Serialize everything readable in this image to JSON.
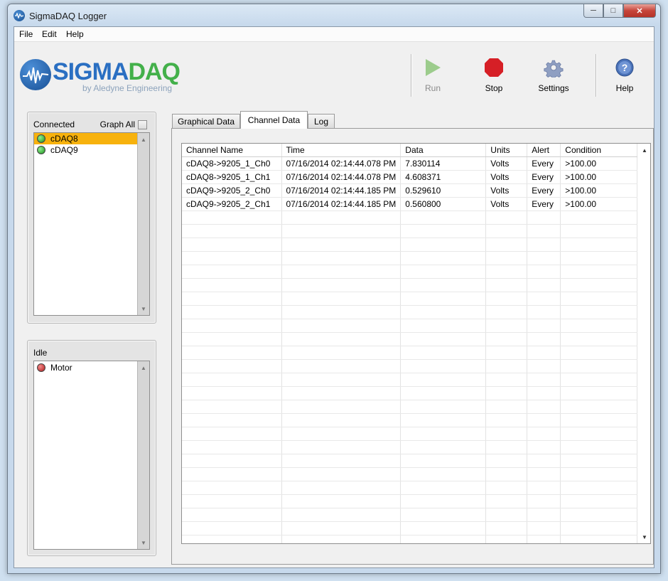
{
  "window": {
    "title": "SigmaDAQ Logger"
  },
  "menu": {
    "file": "File",
    "edit": "Edit",
    "help": "Help"
  },
  "logo": {
    "sigma": "SIGMA",
    "daq": "DAQ",
    "subtitle": "by Aledyne Engineering"
  },
  "toolbar": {
    "run": "Run",
    "stop": "Stop",
    "settings": "Settings",
    "help": "Help"
  },
  "connected": {
    "header": "Connected",
    "graph_all": "Graph All",
    "devices": [
      {
        "name": "cDAQ8",
        "status": "green"
      },
      {
        "name": "cDAQ9",
        "status": "green"
      }
    ]
  },
  "idle": {
    "header": "Idle",
    "devices": [
      {
        "name": "Motor",
        "status": "red"
      }
    ]
  },
  "tabs": [
    {
      "label": "Graphical Data"
    },
    {
      "label": "Channel Data"
    },
    {
      "label": "Log"
    }
  ],
  "table": {
    "columns": [
      "Channel Name",
      "Time",
      "Data",
      "Units",
      "Alert",
      "Condition"
    ],
    "rows": [
      [
        "cDAQ8->9205_1_Ch0",
        "07/16/2014 02:14:44.078 PM",
        "7.830114",
        "Volts",
        "Every",
        ">100.00"
      ],
      [
        "cDAQ8->9205_1_Ch1",
        "07/16/2014 02:14:44.078 PM",
        "4.608371",
        "Volts",
        "Every",
        ">100.00"
      ],
      [
        "cDAQ9->9205_2_Ch0",
        "07/16/2014 02:14:44.185 PM",
        "0.529610",
        "Volts",
        "Every",
        ">100.00"
      ],
      [
        "cDAQ9->9205_2_Ch1",
        "07/16/2014 02:14:44.185 PM",
        "0.560800",
        "Volts",
        "Every",
        ">100.00"
      ]
    ]
  },
  "colors": {
    "selected_row": "#f7b20d",
    "stop": "#d61f26",
    "run": "#9ccc8c",
    "logo_blue": "#2a6fc2",
    "logo_green": "#43b04a"
  }
}
